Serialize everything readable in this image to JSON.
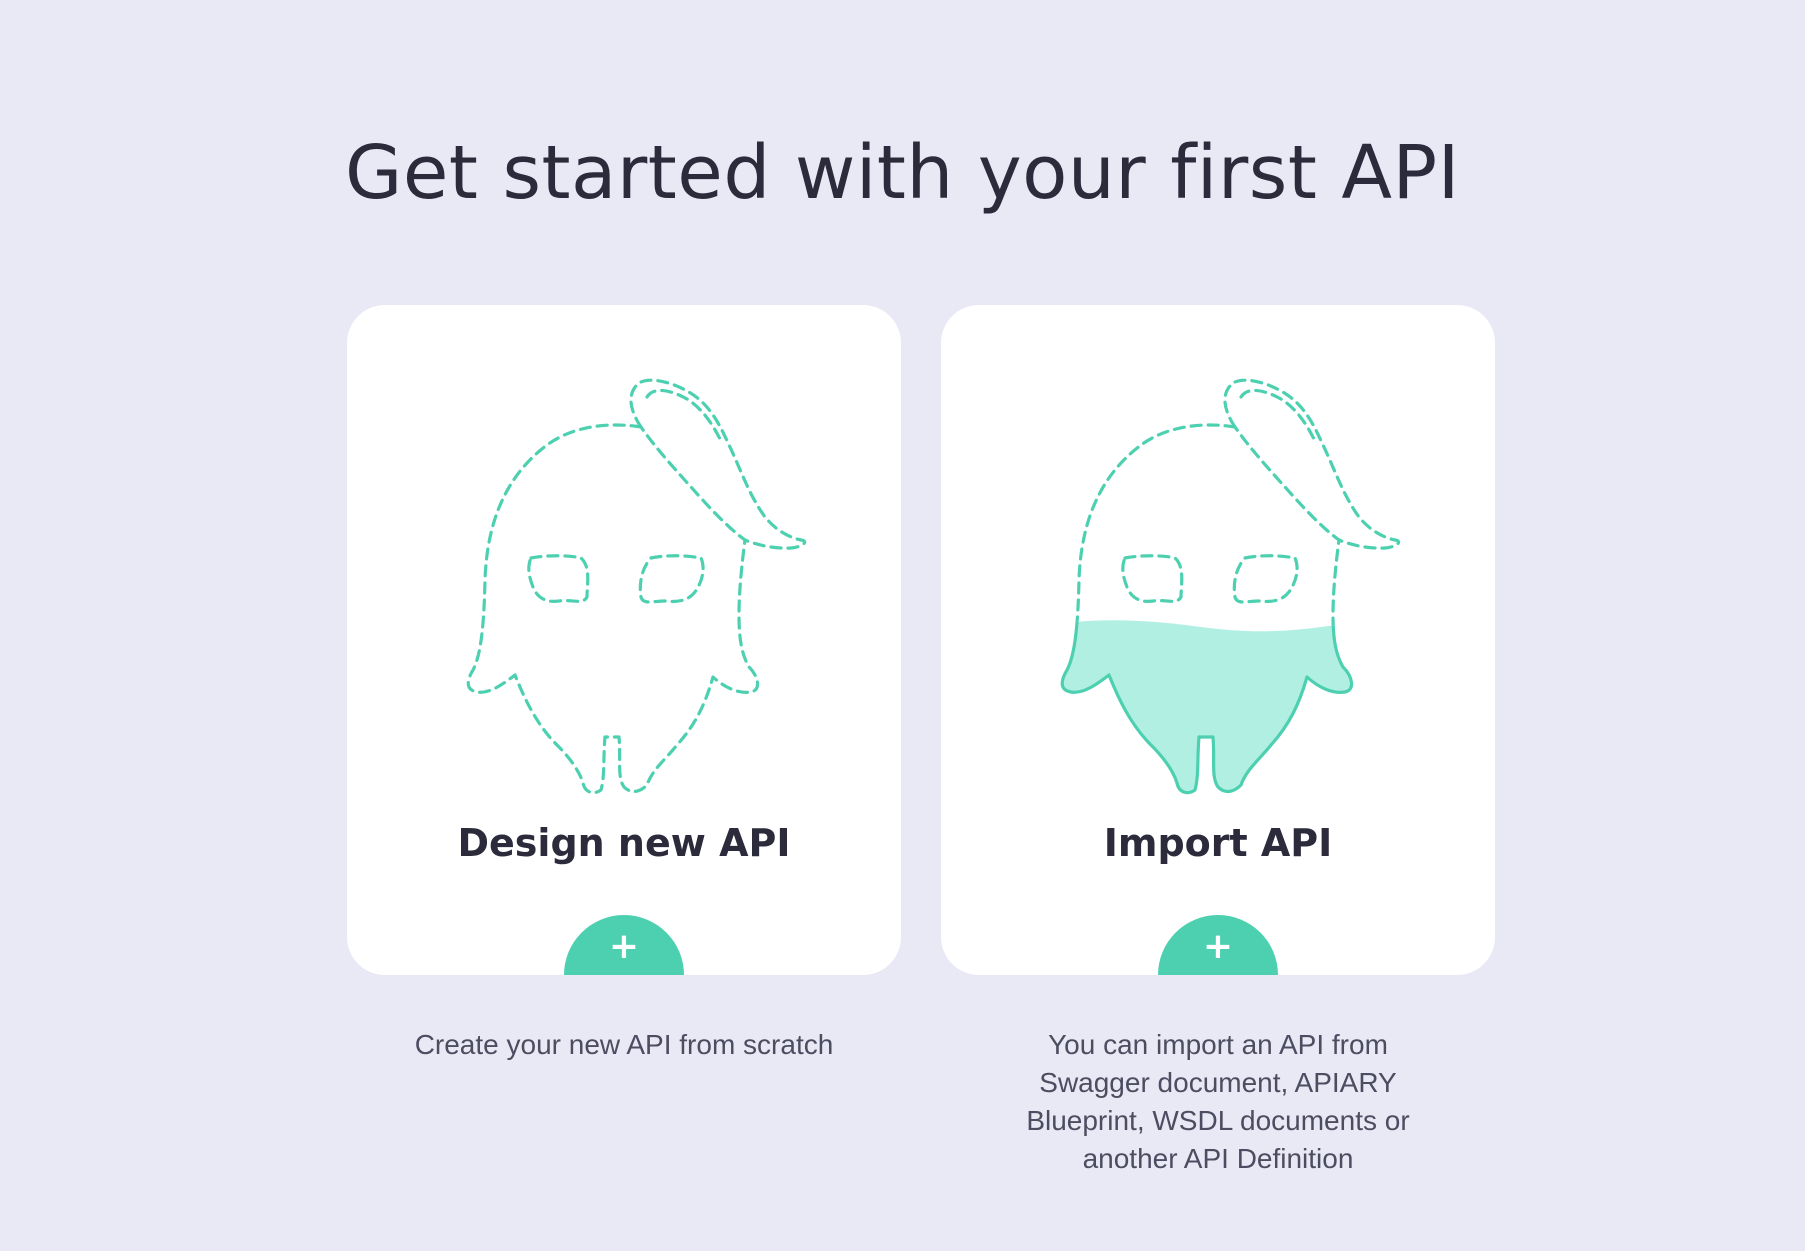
{
  "page": {
    "title": "Get started with your first API"
  },
  "cards": [
    {
      "title": "Design new API",
      "button_icon": "plus-icon",
      "button_glyph": "+",
      "illustration": "mascot-dashed-outline",
      "description": "Create your new API from scratch"
    },
    {
      "title": "Import API",
      "button_icon": "plus-icon",
      "button_glyph": "+",
      "illustration": "mascot-half-filled",
      "description": "You can import an API from Swagger document, APIARY Blueprint, WSDL documents or another API Definition"
    }
  ],
  "colors": {
    "background": "#e9e9f5",
    "card": "#ffffff",
    "accent": "#4dd0b0",
    "accent_fill": "#b2efe3",
    "text_dark": "#2b2b3c",
    "text_muted": "#4d4d61"
  }
}
